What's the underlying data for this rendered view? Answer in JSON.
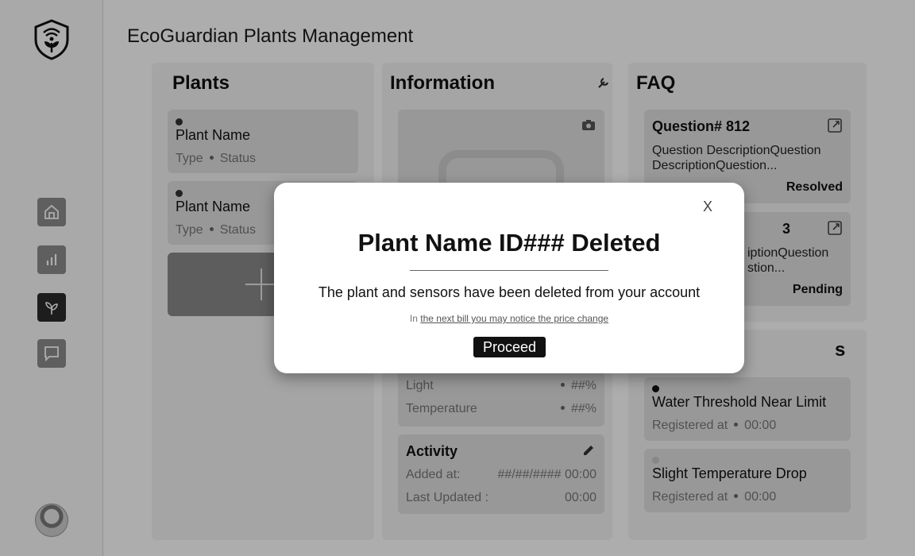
{
  "app": {
    "title": "EcoGuardian Plants Management"
  },
  "sidebar": {
    "items": [
      {
        "icon": "home-icon"
      },
      {
        "icon": "chart-icon"
      },
      {
        "icon": "plant-icon",
        "active": true
      },
      {
        "icon": "chat-icon"
      }
    ]
  },
  "plants": {
    "title": "Plants",
    "items": [
      {
        "name": "Plant Name",
        "type": "Type",
        "status": "Status"
      },
      {
        "name": "Plant Name",
        "type": "Type",
        "status": "Status"
      }
    ]
  },
  "information": {
    "title": "Information",
    "metrics": [
      {
        "label": "Light",
        "value": "##%"
      },
      {
        "label": "Temperature",
        "value": "##%"
      }
    ],
    "activity": {
      "title": "Activity",
      "added_label": "Added at:",
      "added_value": "##/##/#### 00:00",
      "updated_label": "Last Updated :",
      "updated_value": "00:00"
    }
  },
  "faq": {
    "title": "FAQ",
    "items": [
      {
        "title": "Question# 812",
        "description": "Question DescriptionQuestion DescriptionQuestion...",
        "status": "Resolved"
      },
      {
        "title_fragment": "3",
        "description_fragment_1": "iptionQuestion",
        "description_fragment_2": "stion...",
        "status": "Pending"
      }
    ]
  },
  "alerts": {
    "title_fragment": "s",
    "items": [
      {
        "title": "Water Threshold Near Limit",
        "registered_label": "Registered at",
        "time": "00:00"
      },
      {
        "title": "Slight Temperature Drop",
        "registered_label": "Registered at",
        "time": "00:00"
      }
    ]
  },
  "modal": {
    "close_label": "X",
    "title": "Plant Name ID### Deleted",
    "message": "The plant and sensors have been deleted from your account",
    "note_prefix": "In ",
    "note_link": "the next bill you may notice the price change",
    "button": "Proceed"
  },
  "colors": {
    "overlay": "#000000",
    "accent": "#111111",
    "card": "#e1e1e1"
  }
}
